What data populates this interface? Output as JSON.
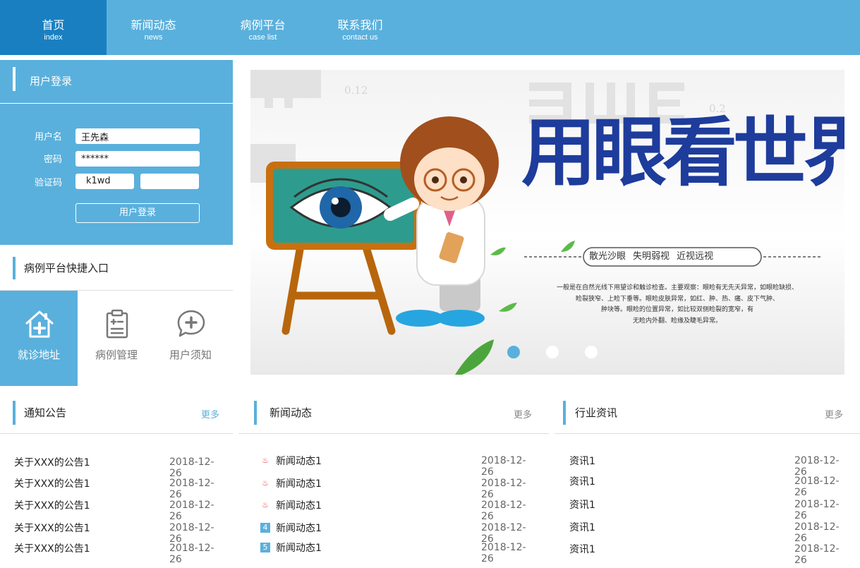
{
  "nav": [
    {
      "zh": "首页",
      "en": "index",
      "active": true
    },
    {
      "zh": "新闻动态",
      "en": "news",
      "active": false
    },
    {
      "zh": "病例平台",
      "en": "case list",
      "active": false
    },
    {
      "zh": "联系我们",
      "en": "contact us",
      "active": false
    }
  ],
  "login": {
    "title": "用户登录",
    "username_label": "用户名",
    "username_value": "王先森",
    "password_label": "密码",
    "password_value": "******",
    "captcha_label": "验证码",
    "captcha_code": "k1wd",
    "captcha_value": "",
    "submit": "用户登录"
  },
  "quick": {
    "title": "病例平台快捷入口",
    "items": [
      {
        "label": "就诊地址",
        "icon": "house-plus-icon",
        "active": true
      },
      {
        "label": "病例管理",
        "icon": "clipboard-icon",
        "active": false
      },
      {
        "label": "用户须知",
        "icon": "chat-plus-icon",
        "active": false
      }
    ]
  },
  "banner": {
    "title": "用眼看世界",
    "tags": [
      "散光沙眼",
      "失明弱视",
      "近视远视"
    ],
    "desc_lines": [
      "一般是在自然光线下用望诊和触诊检查。主要观察：眼睑有无先天异常，如眼睑缺损、",
      "睑裂狭窄、上睑下垂等。眼睑皮肤异常，如红、肿、热、痛、皮下气肿、",
      "肿块等。眼睑的位置异常，如比较双侧睑裂的宽窄，有",
      "无睑内外翻、睑缘及睫毛异常。"
    ],
    "chart_marks": [
      "0.12",
      "0.2"
    ],
    "slides": 3,
    "active_slide": 0
  },
  "notice": {
    "title": "通知公告",
    "more": "更多",
    "items": [
      {
        "text": "关于XXX的公告1",
        "date": "2018-12-26"
      },
      {
        "text": "关于XXX的公告1",
        "date": "2018-12-26"
      },
      {
        "text": "关于XXX的公告1",
        "date": "2018-12-26"
      },
      {
        "text": "关于XXX的公告1",
        "date": "2018-12-26"
      },
      {
        "text": "关于XXX的公告1",
        "date": "2018-12-26"
      }
    ]
  },
  "news": {
    "title": "新闻动态",
    "more": "更多",
    "items": [
      {
        "text": "新闻动态1",
        "date": "2018-12-26",
        "badge": "fire"
      },
      {
        "text": "新闻动态1",
        "date": "2018-12-26",
        "badge": "fire"
      },
      {
        "text": "新闻动态1",
        "date": "2018-12-26",
        "badge": "fire"
      },
      {
        "text": "新闻动态1",
        "date": "2018-12-26",
        "badge": "4"
      },
      {
        "text": "新闻动态1",
        "date": "2018-12-26",
        "badge": "5"
      }
    ]
  },
  "industry": {
    "title": "行业资讯",
    "more": "更多",
    "items": [
      {
        "text": "资讯1",
        "date": "2018-12-26"
      },
      {
        "text": "资讯1",
        "date": "2018-12-26"
      },
      {
        "text": "资讯1",
        "date": "2018-12-26"
      },
      {
        "text": "资讯1",
        "date": "2018-12-26"
      },
      {
        "text": "资讯1",
        "date": "2018-12-26"
      }
    ]
  },
  "colors": {
    "accent": "#5ab0dc",
    "active_nav": "#1a7fc1",
    "more_blue": "#5ab0dc",
    "more_gray": "#888888"
  }
}
